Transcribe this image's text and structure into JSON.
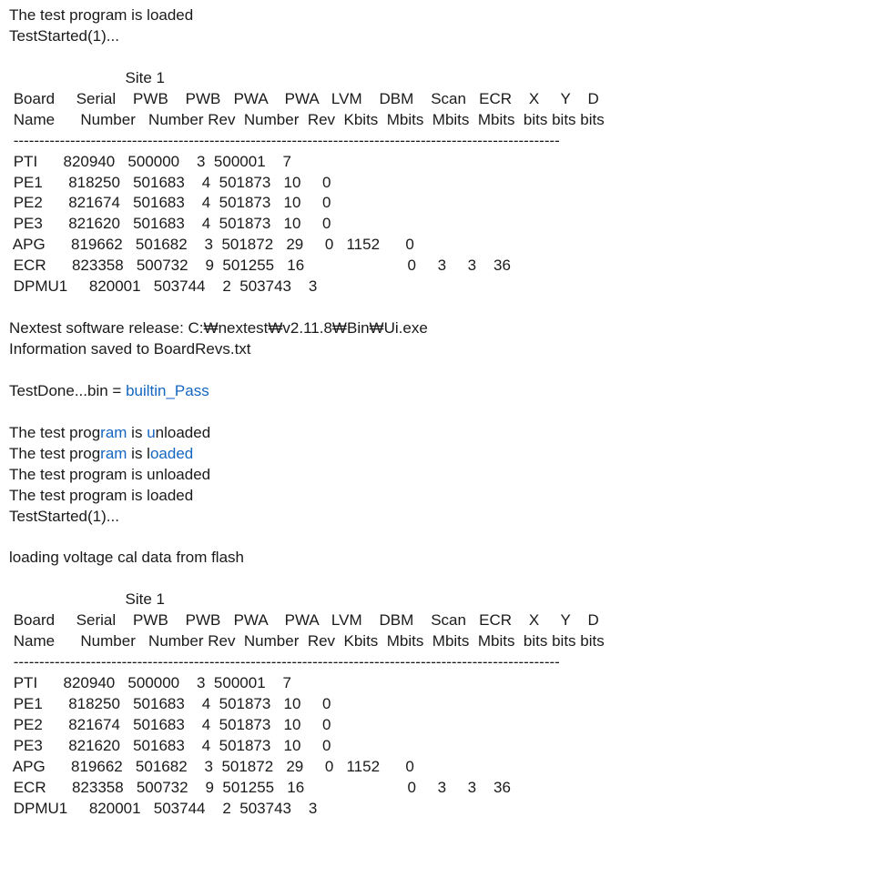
{
  "intro": {
    "line1": "The test program is loaded",
    "line2": "TestStarted(1)..."
  },
  "table1": {
    "site_header": "                           Site 1",
    "header1": " Board     Serial    PWB    PWB   PWA    PWA   LVM    DBM    Scan   ECR    X     Y    D",
    "header2": " Name      Number   Number Rev  Number  Rev  Kbits  Mbits  Mbits  Mbits  bits bits bits",
    "sep": " ----------------------------------------------------------------------------------------------------------",
    "rows": [
      " PTI      820940   500000    3  500001    7",
      " PE1      818250   501683    4  501873   10     0",
      " PE2      821674   501683    4  501873   10     0",
      " PE3      821620   501683    4  501873   10     0",
      " APG      819662   501682    3  501872   29     0   1152      0",
      " ECR      823358   500732    9  501255   16                        0     3     3    36",
      " DPMU1     820001   503744    2  503743    3"
    ]
  },
  "middle": {
    "release": "Nextest software release:  C:₩nextest₩v2.11.8₩Bin₩Ui.exe",
    "saved": "Information saved to BoardRevs.txt",
    "testdone_prefix": "TestDone...bin = ",
    "testdone_value": "builtin_Pass",
    "unload1_a": "The test prog",
    "unload1_b": "ram",
    "unload1_c": " is ",
    "unload1_d": "u",
    "unload1_e": "nloaded",
    "load1_a": "The test prog",
    "load1_b": "ram",
    "load1_c": " is l",
    "load1_d": "oaded",
    "unload2": "The test program is unloaded",
    "load2": "The test program is loaded",
    "started": "TestStarted(1)...",
    "voltage": "loading voltage cal data from flash"
  },
  "table2": {
    "site_header": "                           Site 1",
    "header1": " Board     Serial    PWB    PWB   PWA    PWA   LVM    DBM    Scan   ECR    X     Y    D",
    "header2": " Name      Number   Number Rev  Number  Rev  Kbits  Mbits  Mbits  Mbits  bits bits bits",
    "sep": " ----------------------------------------------------------------------------------------------------------",
    "rows": [
      " PTI      820940   500000    3  500001    7",
      " PE1      818250   501683    4  501873   10     0",
      " PE2      821674   501683    4  501873   10     0",
      " PE3      821620   501683    4  501873   10     0",
      " APG      819662   501682    3  501872   29     0   1152      0",
      " ECR      823358   500732    9  501255   16                        0     3     3    36",
      " DPMU1     820001   503744    2  503743    3"
    ]
  }
}
